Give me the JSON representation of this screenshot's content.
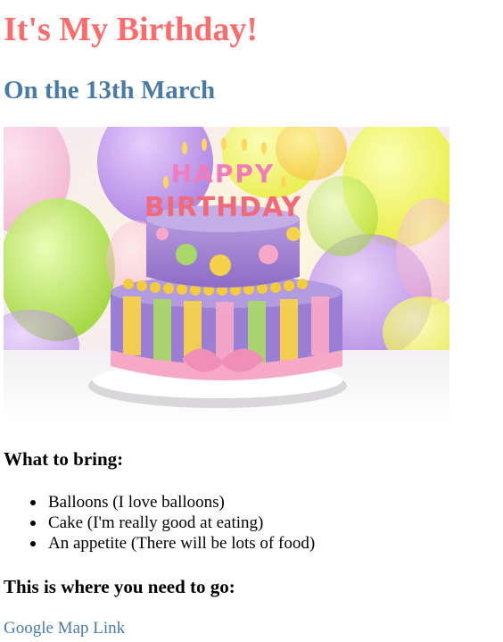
{
  "header": {
    "title": "It's My Birthday!",
    "subtitle": "On the 13th March"
  },
  "image": {
    "cake_letters_top": "HAPPY",
    "cake_letters_bottom": "BIRTHDAY"
  },
  "bring": {
    "heading": "What to bring:",
    "items": [
      "Balloons (I love balloons)",
      "Cake (I'm really good at eating)",
      "An appetite (There will be lots of food)"
    ]
  },
  "location": {
    "heading": "This is where you need to go:",
    "link_label": "Google Map Link"
  },
  "colors": {
    "title": "#ff6b6b",
    "subtitle": "#4a7aa8",
    "link": "#4a7aa8"
  }
}
